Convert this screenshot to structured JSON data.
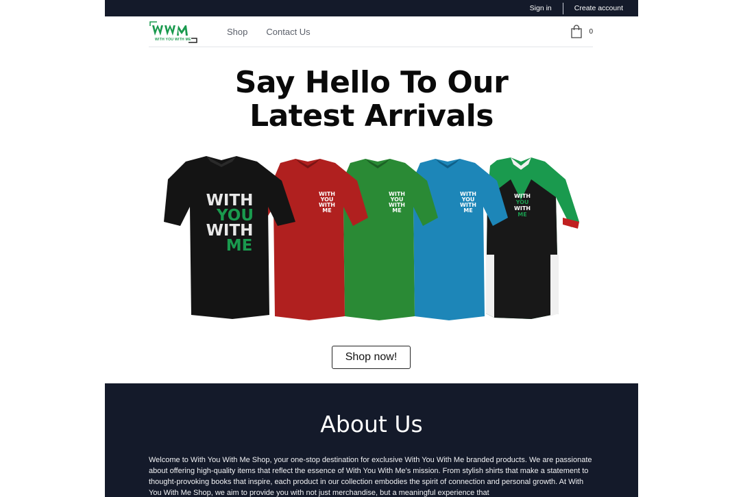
{
  "topbar": {
    "sign_in": "Sign in",
    "create_account": "Create account"
  },
  "nav": {
    "logo_text_top": "WWM",
    "logo_text_bottom": "WITH YOU WITH ME",
    "links": [
      "Shop",
      "Contact Us"
    ],
    "cart_count": "0"
  },
  "hero": {
    "title_line1": "Say Hello To Our",
    "title_line2": "Latest Arrivals",
    "shirt_print": [
      "WITH",
      "YOU",
      "WITH",
      "ME"
    ],
    "cta": "Shop now!"
  },
  "about": {
    "title": "About Us",
    "body": "Welcome to With You With Me Shop, your one-stop destination for exclusive With You With Me branded products. We are passionate about offering high-quality items that reflect the essence of With You With Me's mission. From stylish shirts that make a statement to thought-provoking books that inspire, each product in our collection embodies the spirit of connection and personal growth. At With You With Me Shop, we aim to provide you with not just merchandise, but a meaningful experience that"
  },
  "colors": {
    "dark_navy": "#141a2a",
    "brand_green": "#1a9a4e",
    "shirt_black": "#141414",
    "shirt_red": "#b0201f",
    "shirt_green": "#2a8a35",
    "shirt_blue": "#1d86b8"
  },
  "icons": {
    "cart": "shopping-bag-icon"
  }
}
